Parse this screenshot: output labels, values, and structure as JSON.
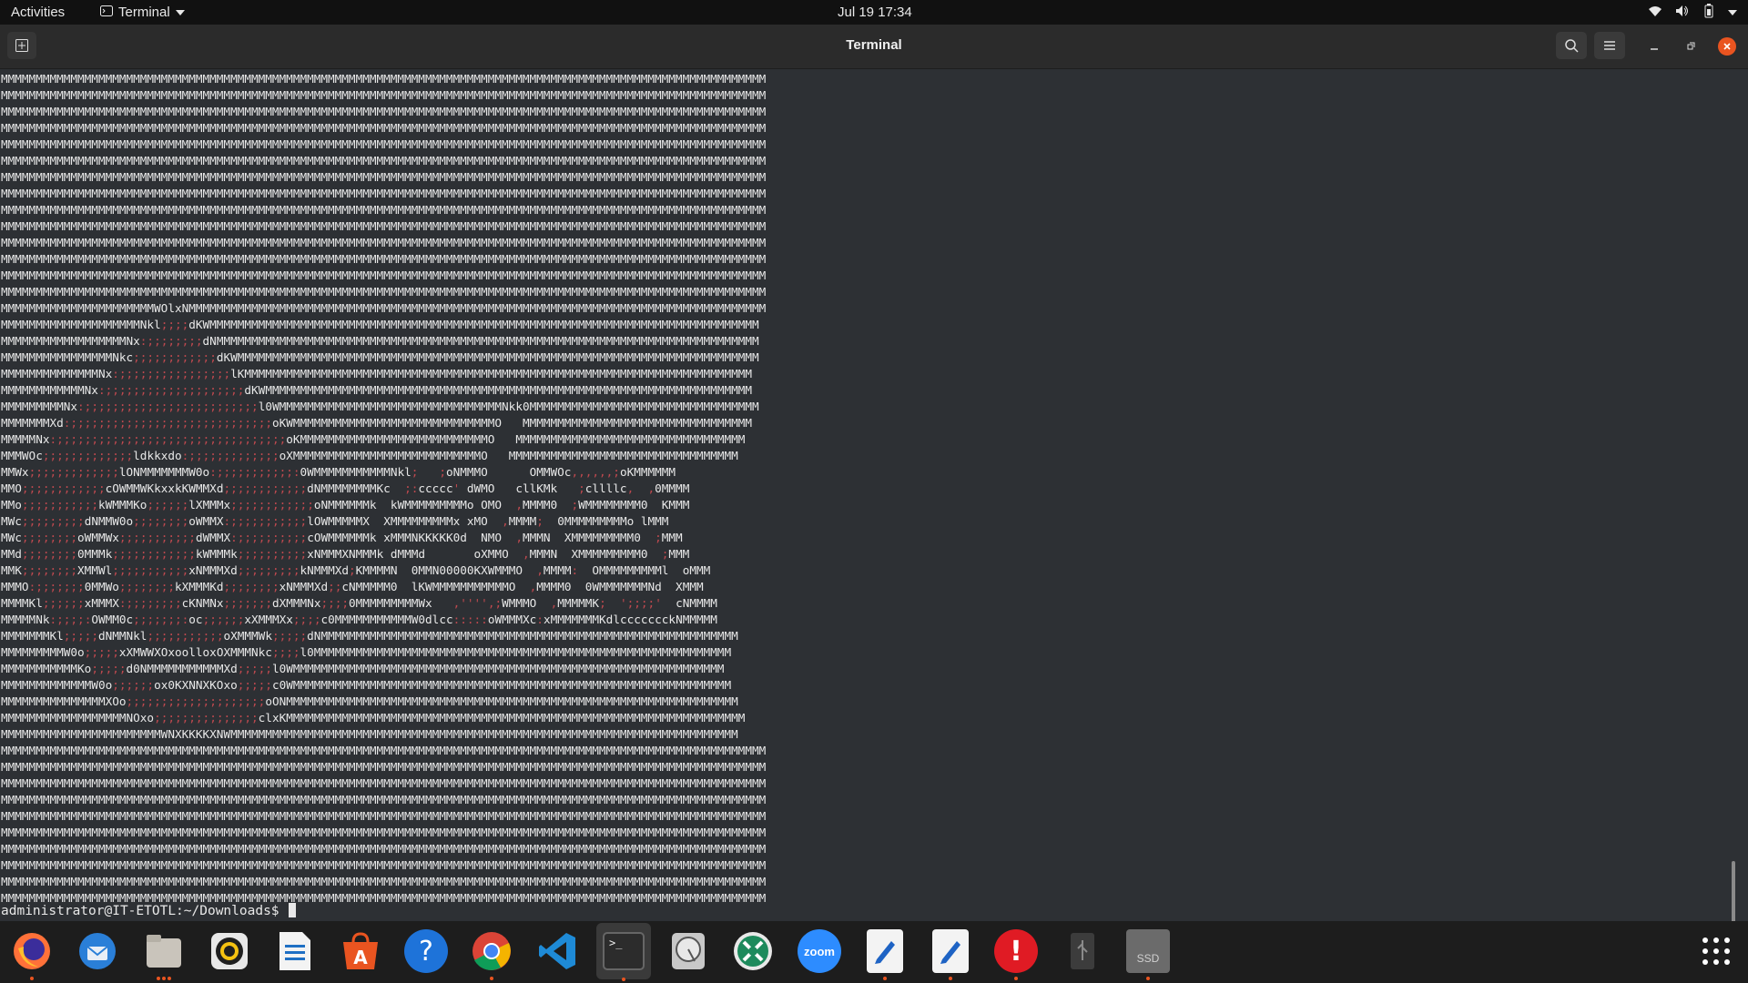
{
  "topbar": {
    "activities": "Activities",
    "app_menu": "Terminal",
    "clock": "Jul 19  17:34"
  },
  "window": {
    "title": "Terminal"
  },
  "terminal": {
    "ascii_art": [
      "MMMMMMMMMMMMMMMMMMMMMMMMMMMMMMMMMMMMMMMMMMMMMMMMMMMMMMMMMMMMMMMMMMMMMMMMMMMMMMMMMMMMMMMMMMMMMMMMMMMMMMMMMMMMMM",
      "MMMMMMMMMMMMMMMMMMMMMMMMMMMMMMMMMMMMMMMMMMMMMMMMMMMMMMMMMMMMMMMMMMMMMMMMMMMMMMMMMMMMMMMMMMMMMMMMMMMMMMMMMMMMMM",
      "MMMMMMMMMMMMMMMMMMMMMMMMMMMMMMMMMMMMMMMMMMMMMMMMMMMMMMMMMMMMMMMMMMMMMMMMMMMMMMMMMMMMMMMMMMMMMMMMMMMMMMMMMMMMMM",
      "MMMMMMMMMMMMMMMMMMMMMMMMMMMMMMMMMMMMMMMMMMMMMMMMMMMMMMMMMMMMMMMMMMMMMMMMMMMMMMMMMMMMMMMMMMMMMMMMMMMMMMMMMMMMMM",
      "MMMMMMMMMMMMMMMMMMMMMMMMMMMMMMMMMMMMMMMMMMMMMMMMMMMMMMMMMMMMMMMMMMMMMMMMMMMMMMMMMMMMMMMMMMMMMMMMMMMMMMMMMMMMMM",
      "MMMMMMMMMMMMMMMMMMMMMMMMMMMMMMMMMMMMMMMMMMMMMMMMMMMMMMMMMMMMMMMMMMMMMMMMMMMMMMMMMMMMMMMMMMMMMMMMMMMMMMMMMMMMMM",
      "MMMMMMMMMMMMMMMMMMMMMMMMMMMMMMMMMMMMMMMMMMMMMMMMMMMMMMMMMMMMMMMMMMMMMMMMMMMMMMMMMMMMMMMMMMMMMMMMMMMMMMMMMMMMMM",
      "MMMMMMMMMMMMMMMMMMMMMMMMMMMMMMMMMMMMMMMMMMMMMMMMMMMMMMMMMMMMMMMMMMMMMMMMMMMMMMMMMMMMMMMMMMMMMMMMMMMMMMMMMMMMMM",
      "MMMMMMMMMMMMMMMMMMMMMMMMMMMMMMMMMMMMMMMMMMMMMMMMMMMMMMMMMMMMMMMMMMMMMMMMMMMMMMMMMMMMMMMMMMMMMMMMMMMMMMMMMMMMMM",
      "MMMMMMMMMMMMMMMMMMMMMMMMMMMMMMMMMMMMMMMMMMMMMMMMMMMMMMMMMMMMMMMMMMMMMMMMMMMMMMMMMMMMMMMMMMMMMMMMMMMMMMMMMMMMMM",
      "MMMMMMMMMMMMMMMMMMMMMMMMMMMMMMMMMMMMMMMMMMMMMMMMMMMMMMMMMMMMMMMMMMMMMMMMMMMMMMMMMMMMMMMMMMMMMMMMMMMMMMMMMMMMMM",
      "MMMMMMMMMMMMMMMMMMMMMMMMMMMMMMMMMMMMMMMMMMMMMMMMMMMMMMMMMMMMMMMMMMMMMMMMMMMMMMMMMMMMMMMMMMMMMMMMMMMMMMMMMMMMMM",
      "MMMMMMMMMMMMMMMMMMMMMMMMMMMMMMMMMMMMMMMMMMMMMMMMMMMMMMMMMMMMMMMMMMMMMMMMMMMMMMMMMMMMMMMMMMMMMMMMMMMMMMMMMMMMMM",
      "MMMMMMMMMMMMMMMMMMMMMMMMMMMMMMMMMMMMMMMMMMMMMMMMMMMMMMMMMMMMMMMMMMMMMMMMMMMMMMMMMMMMMMMMMMMMMMMMMMMMMMMMMMMMMM",
      "MMMMMMMMMMMMMMMMMMMMMMWOlxNMMMMMMMMMMMMMMMMMMMMMMMMMMMMMMMMMMMMMMMMMMMMMMMMMMMMMMMMMMMMMMMMMMMMMMMMMMMMMMMMMMM",
      "MMMMMMMMMMMMMMMMMMMMNkl;;;;dKWMMMMMMMMMMMMMMMMMMMMMMMMMMMMMMMMMMMMMMMMMMMMMMMMMMMMMMMMMMMMMMMMMMMMMMMMMMMMMMM",
      "MMMMMMMMMMMMMMMMMMNx:;;;;;;;;dNMMMMMMMMMMMMMMMMMMMMMMMMMMMMMMMMMMMMMMMMMMMMMMMMMMMMMMMMMMMMMMMMMMMMMMMMMMMMMM",
      "MMMMMMMMMMMMMMMMNkc;;;;;;;;;;;;dKWMMMMMMMMMMMMMMMMMMMMMMMMMMMMMMMMMMMMMMMMMMMMMMMMMMMMMMMMMMMMMMMMMMMMMMMMMMM",
      "MMMMMMMMMMMMMMNx:;;;;;;;;;;;;;;;;lKMMMMMMMMMMMMMMMMMMMMMMMMMMMMMMMMMMMMMMMMMMMMMMMMMMMMMMMMMMMMMMMMMMMMMMMMM",
      "MMMMMMMMMMMMNx:;;;;;;;;;;;;;;;;;;;;dKWMMMMMMMMMMMMMMMMMMMMMMMMMMMMMMMMMMMMMMMMMMMMMMMMMMMMMMMMMMMMMMMMMMMMMM",
      "MMMMMMMMMNx:;;;;;;;;;;;;;;;;;;;;;;;;;l0WMMMMMMMMMMMMMMMMMMMMMMMMMMMMMMMMNkk0MMMMMMMMMMMMMMMMMMMMMMMMMMMMMMMMM",
      "MMMMMMMXd:;;;;;;;;;;;;;;;;;;;;;;;;;;;;;oKWMMMMMMMMMMMMMMMMMMMMMMMMMMMMMO   MMMMMMMMMMMMMMMMMMMMMMMMMMMMMMMMM",
      "MMMMMNx:;;;;;;;;;;;;;;;;;;;;;;;;;;;;;;;;;oKMMMMMMMMMMMMMMMMMMMMMMMMMMMO   MMMMMMMMMMMMMMMMMMMMMMMMMMMMMMMMM",
      "MMMWOc;;;;;;;;;;;;;ldkkxdo:;;;;;;;;;;;;;oXMMMMMMMMMMMMMMMMMMMMMMMMMMMO   MMMMMMMMMMMMMMMMMMMMMMMMMMMMMMMMM",
      "MMWx;;;;;;;;;;;;;lONMMMMMMMW0o:;;;;;;;;;;;:0WMMMMMMMMMMMNkl;   ;oNMMMO      OMMWOc,,,,,,;oKMMMMMM",
      "MMO;;;;;;;;;;;;cOWMMWKkxxkKWMMXd;;;;;;;;;;;;dNMMMMMMMMKc  ;:ccccc' dWMO   cllKMk   ;cllllc,  ,0MMMM",
      "MMo;;;;;;;;;;;kWMMMKo;;;;;;lXMMMx;;;;;;;;;;;;oNMMMMMMk  kWMMMMMMMMMo OMO  ,MMMM0  ;WMMMMMMMM0  KMMM",
      "MWc;;;;;;;;;dNMMW0o;;;;;;;;oWMMX:;;;;;;;;;;;lOWMMMMMX  XMMMMMMMMMx xMO  ,MMMM;  0MMMMMMMMMo lMMM",
      "MWc;;;;;;;;oWMMWx;;;;;;;;;;;dWMMX:;;;;;;;;;;cOWMMMMMMk xMMMNKKKKK0d  NMO  ,MMMN  XMMMMMMMMM0  ;MMM",
      "MMd;;;;;;;;0MMMk;;;;;;;;;;;;kWMMMk;;;;;;;;;;xNMMMXNMMMk dMMMd       oXMMO  ,MMMN  XMMMMMMMMM0  ;MMM",
      "MMK;;;;;;;;XMMWl;;;;;;;;;;;xNMMMXd;;;;;;;;;kNMMMXd;KMMMMN  0MMN00000KXWMMMO  ,MMMM:  OMMMMMMMMMl  oMMM",
      "MMMO:;;;;;;;0MMWo;;;;;;;;kXMMMKd;;;;;;;;xNMMMXd;;cNMMMMM0  lKWMMMMMMMMMMMO  ,MMMM0  0WMMMMMMMNd  XMMM",
      "MMMMKl;;;;;;xMMMX:;;;;;;;;cKNMNx;;;;;;;dXMMMNx;;;;0MMMMMMMMMWx   ,'''',;WMMMO  ,MMMMMK;  ';;;;'  cNMMMM",
      "MMMMMNk:;;;;:OWMM0c;;;;;;;:oc;;;;;;xXMMMXx;;;;c0MMMMMMMMMMMW0dlcc:::::oWMMMXc:xMMMMMMMKdlccccccckNMMMMM",
      "MMMMMMMKl;;;;;dNMMNkl;;;;;;;;;;;oXMMMWk;;;;;dNMMMMMMMMMMMMMMMMMMMMMMMMMMMMMMMMMMMMMMMMMMMMMMMMMMMMMMMMMMMM",
      "MMMMMMMMMW0o;;;;;xXMWWXOxoolloxOXMMMNkc;;;;l0MMMMMMMMMMMMMMMMMMMMMMMMMMMMMMMMMMMMMMMMMMMMMMMMMMMMMMMMMMMM",
      "MMMMMMMMMMMKo;;;;;d0NMMMMMMMMMMMXd;;;;;l0WMMMMMMMMMMMMMMMMMMMMMMMMMMMMMMMMMMMMMMMMMMMMMMMMMMMMMMMMMMMMMM",
      "MMMMMMMMMMMMMW0o;;;;;;ox0KXNNXKOxo;;;;;c0WMMMMMMMMMMMMMMMMMMMMMMMMMMMMMMMMMMMMMMMMMMMMMMMMMMMMMMMMMMMMMMM",
      "MMMMMMMMMMMMMMMXOo;;;;;;;;;;;;;;;;;;;;oONMMMMMMMMMMMMMMMMMMMMMMMMMMMMMMMMMMMMMMMMMMMMMMMMMMMMMMMMMMMMMMMMM",
      "MMMMMMMMMMMMMMMMMMNOxo;;;;;;;;;;;;;;;clxKMMMMMMMMMMMMMMMMMMMMMMMMMMMMMMMMMMMMMMMMMMMMMMMMMMMMMMMMMMMMMMMMMM",
      "MMMMMMMMMMMMMMMMMMMMMMMWNXKKKKXNWMMMMMMMMMMMMMMMMMMMMMMMMMMMMMMMMMMMMMMMMMMMMMMMMMMMMMMMMMMMMMMMMMMMMMMMMM",
      "MMMMMMMMMMMMMMMMMMMMMMMMMMMMMMMMMMMMMMMMMMMMMMMMMMMMMMMMMMMMMMMMMMMMMMMMMMMMMMMMMMMMMMMMMMMMMMMMMMMMMMMMMMMMMM",
      "MMMMMMMMMMMMMMMMMMMMMMMMMMMMMMMMMMMMMMMMMMMMMMMMMMMMMMMMMMMMMMMMMMMMMMMMMMMMMMMMMMMMMMMMMMMMMMMMMMMMMMMMMMMMMM",
      "MMMMMMMMMMMMMMMMMMMMMMMMMMMMMMMMMMMMMMMMMMMMMMMMMMMMMMMMMMMMMMMMMMMMMMMMMMMMMMMMMMMMMMMMMMMMMMMMMMMMMMMMMMMMMM",
      "MMMMMMMMMMMMMMMMMMMMMMMMMMMMMMMMMMMMMMMMMMMMMMMMMMMMMMMMMMMMMMMMMMMMMMMMMMMMMMMMMMMMMMMMMMMMMMMMMMMMMMMMMMMMMM",
      "MMMMMMMMMMMMMMMMMMMMMMMMMMMMMMMMMMMMMMMMMMMMMMMMMMMMMMMMMMMMMMMMMMMMMMMMMMMMMMMMMMMMMMMMMMMMMMMMMMMMMMMMMMMMMM",
      "MMMMMMMMMMMMMMMMMMMMMMMMMMMMMMMMMMMMMMMMMMMMMMMMMMMMMMMMMMMMMMMMMMMMMMMMMMMMMMMMMMMMMMMMMMMMMMMMMMMMMMMMMMMMMM",
      "MMMMMMMMMMMMMMMMMMMMMMMMMMMMMMMMMMMMMMMMMMMMMMMMMMMMMMMMMMMMMMMMMMMMMMMMMMMMMMMMMMMMMMMMMMMMMMMMMMMMMMMMMMMMMM",
      "MMMMMMMMMMMMMMMMMMMMMMMMMMMMMMMMMMMMMMMMMMMMMMMMMMMMMMMMMMMMMMMMMMMMMMMMMMMMMMMMMMMMMMMMMMMMMMMMMMMMMMMMMMMMMM",
      "MMMMMMMMMMMMMMMMMMMMMMMMMMMMMMMMMMMMMMMMMMMMMMMMMMMMMMMMMMMMMMMMMMMMMMMMMMMMMMMMMMMMMMMMMMMMMMMMMMMMMMMMMMMMMM",
      "MMMMMMMMMMMMMMMMMMMMMMMMMMMMMMMMMMMMMMMMMMMMMMMMMMMMMMMMMMMMMMMMMMMMMMMMMMMMMMMMMMMMMMMMMMMMMMMMMMMMMMMMMMMMMM"
    ],
    "prompt": "administrator@IT-ETOTL:~/Downloads$"
  },
  "dock": {
    "items": [
      {
        "name": "firefox",
        "label": "",
        "active": true
      },
      {
        "name": "thunderbird",
        "label": "",
        "active": false
      },
      {
        "name": "files",
        "label": "",
        "active": true
      },
      {
        "name": "rhythmbox",
        "label": "",
        "active": false
      },
      {
        "name": "libreoffice-writer",
        "label": "",
        "active": false
      },
      {
        "name": "software",
        "label": "",
        "active": false
      },
      {
        "name": "help",
        "label": "?",
        "active": false
      },
      {
        "name": "chrome",
        "label": "",
        "active": true
      },
      {
        "name": "vscode",
        "label": "",
        "active": false
      },
      {
        "name": "terminal",
        "label": ">_",
        "active": true
      },
      {
        "name": "disk-utility",
        "label": "",
        "active": false
      },
      {
        "name": "remote-desktop",
        "label": "",
        "active": false
      },
      {
        "name": "zoom",
        "label": "zoom",
        "active": false
      },
      {
        "name": "text-editor-1",
        "label": "",
        "active": true
      },
      {
        "name": "text-editor-2",
        "label": "",
        "active": true
      },
      {
        "name": "update-notifier",
        "label": "!",
        "active": true
      },
      {
        "name": "usb-drive",
        "label": "",
        "active": false
      },
      {
        "name": "ssd-drive",
        "label": "SSD",
        "active": true
      }
    ]
  }
}
